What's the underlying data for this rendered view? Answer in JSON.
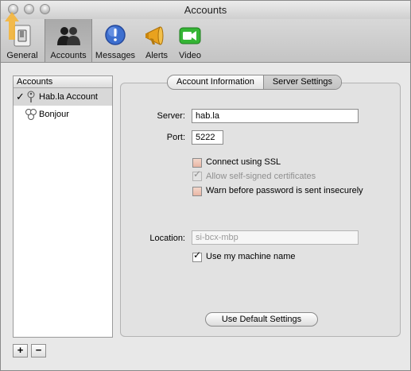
{
  "window": {
    "title": "Accounts"
  },
  "toolbar": {
    "items": [
      {
        "label": "General",
        "selected": false,
        "icon": "switch-icon"
      },
      {
        "label": "Accounts",
        "selected": true,
        "icon": "people-icon"
      },
      {
        "label": "Messages",
        "selected": false,
        "icon": "messages-icon"
      },
      {
        "label": "Alerts",
        "selected": false,
        "icon": "megaphone-icon"
      },
      {
        "label": "Video",
        "selected": false,
        "icon": "camera-icon"
      }
    ]
  },
  "accounts_list": {
    "header": "Accounts",
    "items": [
      {
        "label": "Hab.la Account",
        "checked": true,
        "selected": true,
        "icon": "key-icon"
      },
      {
        "label": "Bonjour",
        "checked": false,
        "selected": false,
        "icon": "bonjour-icon"
      }
    ],
    "add_label": "+",
    "remove_label": "−"
  },
  "tabs": {
    "account_information": "Account Information",
    "server_settings": "Server Settings",
    "selected": "server_settings"
  },
  "server": {
    "label": "Server:",
    "value": "hab.la"
  },
  "port": {
    "label": "Port:",
    "value": "5222"
  },
  "options": {
    "ssl": {
      "label": "Connect using SSL",
      "checked": false,
      "enabled": true
    },
    "self_signed": {
      "label": "Allow self-signed certificates",
      "checked": true,
      "enabled": false
    },
    "warn_insecure": {
      "label": "Warn before password is sent insecurely",
      "checked": false,
      "enabled": true
    }
  },
  "location": {
    "label": "Location:",
    "placeholder": "si-bcx-mbp",
    "enabled": false
  },
  "use_machine_name": {
    "label": "Use my machine name",
    "checked": true
  },
  "default_button": {
    "label": "Use Default Settings"
  },
  "colors": {
    "highlight_arrow": "#f7b431",
    "checkbox_fill": "#e9b6a4"
  }
}
